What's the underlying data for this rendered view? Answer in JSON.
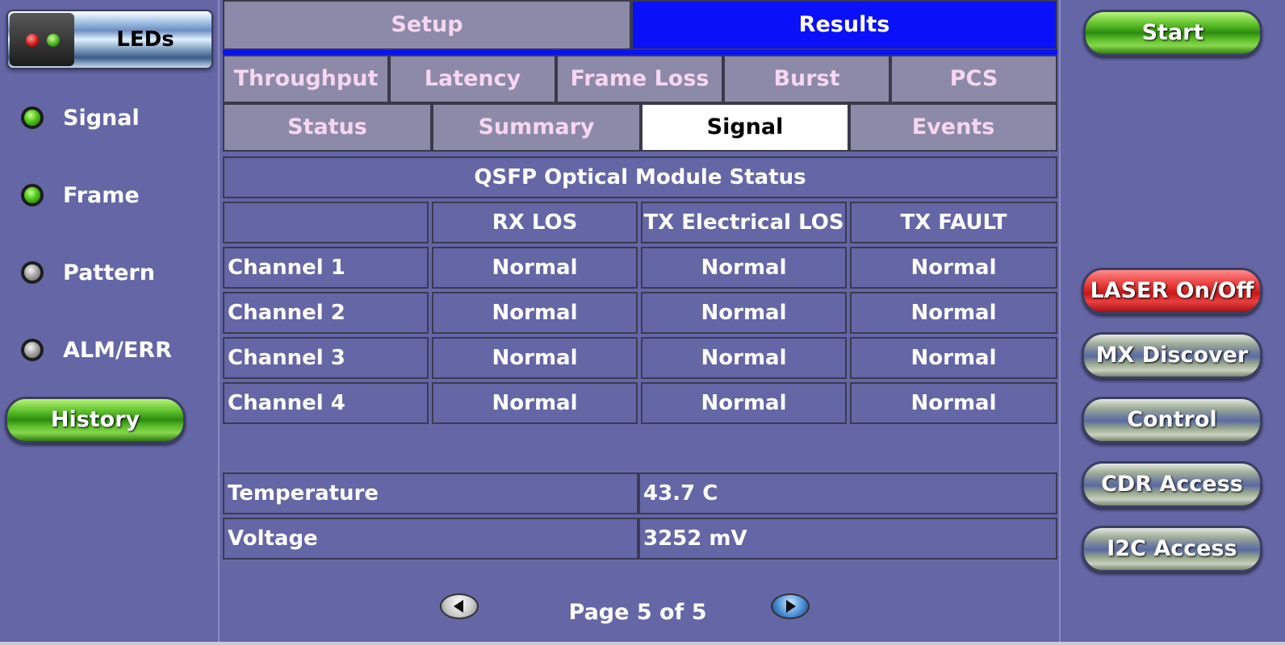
{
  "sidebar": {
    "leds_title": "LEDs",
    "leds": [
      {
        "label": "Signal",
        "state": "green"
      },
      {
        "label": "Frame",
        "state": "green"
      },
      {
        "label": "Pattern",
        "state": "grey"
      },
      {
        "label": "ALM/ERR",
        "state": "grey"
      }
    ],
    "history_label": "History"
  },
  "main_tabs": [
    "Setup",
    "Results"
  ],
  "result_tabs": [
    "Throughput",
    "Latency",
    "Frame Loss",
    "Burst",
    "PCS"
  ],
  "sub_tabs": [
    "Status",
    "Summary",
    "Signal",
    "Events"
  ],
  "table": {
    "title": "QSFP Optical Module Status",
    "headers": [
      "",
      "RX LOS",
      "TX Electrical LOS",
      "TX FAULT"
    ],
    "rows": [
      [
        "Channel 1",
        "Normal",
        "Normal",
        "Normal"
      ],
      [
        "Channel 2",
        "Normal",
        "Normal",
        "Normal"
      ],
      [
        "Channel 3",
        "Normal",
        "Normal",
        "Normal"
      ],
      [
        "Channel 4",
        "Normal",
        "Normal",
        "Normal"
      ]
    ]
  },
  "measurements": [
    {
      "label": "Temperature",
      "value": "43.7 C"
    },
    {
      "label": "Voltage",
      "value": "3252 mV"
    }
  ],
  "pagination": {
    "text": "Page 5 of 5"
  },
  "right_buttons": {
    "start": "Start",
    "laser": "LASER On/Off",
    "mx_discover": "MX Discover",
    "control": "Control",
    "cdr_access": "CDR Access",
    "i2c_access": "I2C Access"
  },
  "colors": {
    "background": "#6466a6",
    "results_tab": "#0a10f8",
    "tab": "#8c8aa8",
    "tab_text": "#f6d6f0"
  }
}
